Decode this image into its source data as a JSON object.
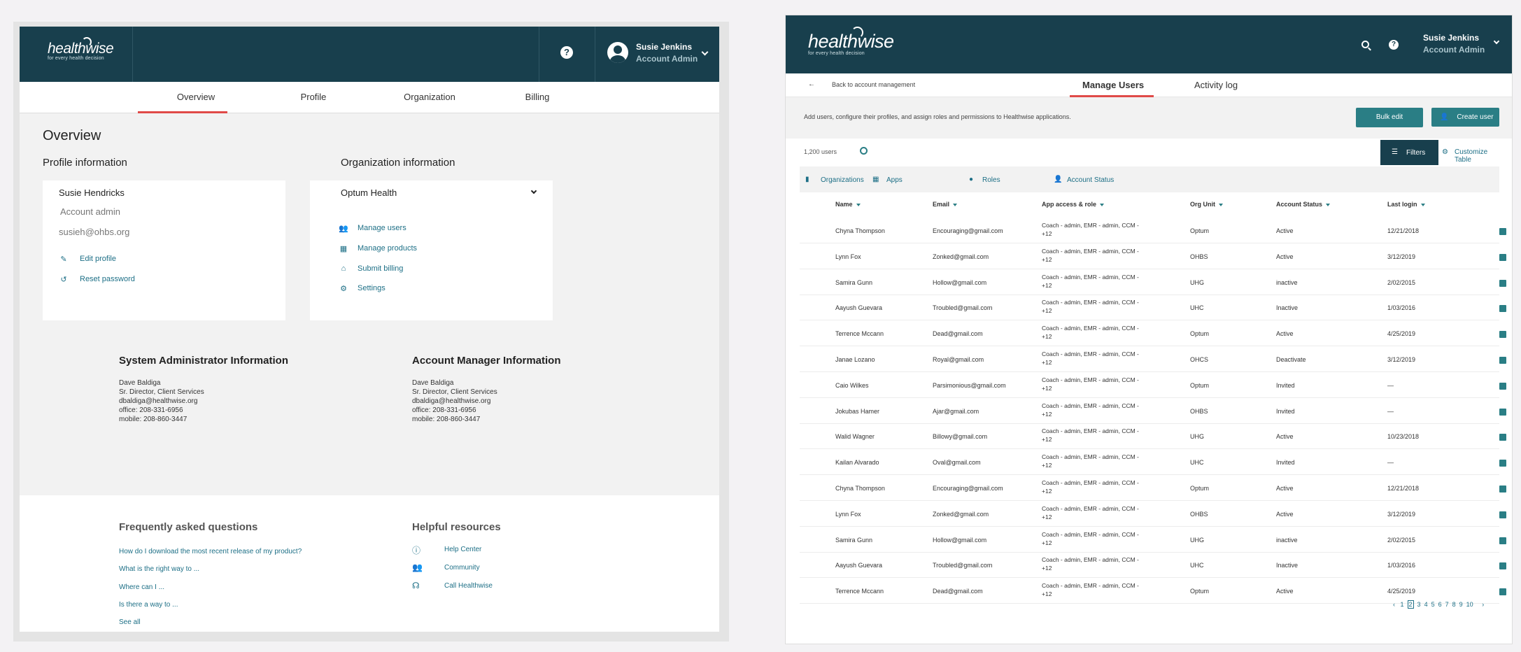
{
  "left": {
    "user": {
      "name": "Susie Jenkins",
      "role": "Account Admin"
    },
    "logo": {
      "word": "healthwise",
      "tagline": "for every health decision"
    },
    "tabs": [
      "Overview",
      "Profile",
      "Organization",
      "Billing"
    ],
    "page_title": "Overview",
    "profile": {
      "heading": "Profile information",
      "name": "Susie Hendricks",
      "role": "Account admin",
      "email": "susieh@ohbs.org",
      "edit_label": "Edit profile",
      "reset_label": "Reset password"
    },
    "org": {
      "heading": "Organization information",
      "selected": "Optum Health",
      "links": [
        "Manage users",
        "Manage products",
        "Submit billing",
        "Settings"
      ]
    },
    "sysadmin": {
      "title": "System Administrator Information",
      "lines": [
        "Dave Baldiga",
        "Sr. Director, Client Services",
        "dbaldiga@healthwise.org",
        "office: 208-331-6956",
        "mobile: 208-860-3447"
      ]
    },
    "acctmgr": {
      "title": "Account Manager Information",
      "lines": [
        "Dave Baldiga",
        "Sr. Director, Client Services",
        "dbaldiga@healthwise.org",
        "office: 208-331-6956",
        "mobile: 208-860-3447"
      ]
    },
    "faq": {
      "title": "Frequently asked questions",
      "links": [
        "How do I download the most recent release of my product?",
        "What is the right way to ...",
        "Where can I ...",
        "Is there a way to ...",
        "See all"
      ]
    },
    "resources": {
      "title": "Helpful resources",
      "links": [
        "Help Center",
        "Community",
        "Call Healthwise"
      ]
    }
  },
  "right": {
    "user": {
      "name": "Susie Jenkins",
      "role": "Account Admin"
    },
    "logo": {
      "word": "healthwise",
      "tagline": "for every health decision"
    },
    "back_label": "Back to account management",
    "tabs": [
      "Manage Users",
      "Activity log"
    ],
    "description": "Add users, configure their profiles, and assign roles and permissions to Healthwise applications.",
    "bulk_edit": "Bulk edit",
    "create_user": "Create user",
    "user_count": "1,200 users",
    "filters_label": "Filters",
    "customize_label": "Customize Table",
    "filter_tabs": [
      "Organizations",
      "Apps",
      "Roles",
      "Account Status"
    ],
    "columns": [
      "Name",
      "Email",
      "App access & role",
      "Org Unit",
      "Account Status",
      "Last login"
    ],
    "app_access": [
      "Coach - admin, EMR - admin, CCM -",
      "+12"
    ],
    "rows": [
      [
        "Chyna Thompson",
        "Encouraging@gmail.com",
        "Optum",
        "Active",
        "12/21/2018"
      ],
      [
        "Lynn Fox",
        "Zonked@gmail.com",
        "OHBS",
        "Active",
        "3/12/2019"
      ],
      [
        "Samira Gunn",
        "Hollow@gmail.com",
        "UHG",
        "inactive",
        "2/02/2015"
      ],
      [
        "Aayush Guevara",
        "Troubled@gmail.com",
        "UHC",
        "Inactive",
        "1/03/2016"
      ],
      [
        "Terrence Mccann",
        "Dead@gmail.com",
        "Optum",
        "Active",
        "4/25/2019"
      ],
      [
        "Janae Lozano",
        "Royal@gmail.com",
        "OHCS",
        "Deactivate",
        "3/12/2019"
      ],
      [
        "Caio Wilkes",
        "Parsimonious@gmail.com",
        "Optum",
        "Invited",
        "—"
      ],
      [
        "Jokubas Hamer",
        "Ajar@gmail.com",
        "OHBS",
        "Invited",
        "—"
      ],
      [
        "Walid Wagner",
        "Billowy@gmail.com",
        "UHG",
        "Active",
        "10/23/2018"
      ],
      [
        "Kailan Alvarado",
        "Oval@gmail.com",
        "UHC",
        "Invited",
        "—"
      ],
      [
        "Chyna Thompson",
        "Encouraging@gmail.com",
        "Optum",
        "Active",
        "12/21/2018"
      ],
      [
        "Lynn Fox",
        "Zonked@gmail.com",
        "OHBS",
        "Active",
        "3/12/2019"
      ],
      [
        "Samira Gunn",
        "Hollow@gmail.com",
        "UHG",
        "inactive",
        "2/02/2015"
      ],
      [
        "Aayush Guevara",
        "Troubled@gmail.com",
        "UHC",
        "Inactive",
        "1/03/2016"
      ],
      [
        "Terrence Mccann",
        "Dead@gmail.com",
        "Optum",
        "Active",
        "4/25/2019"
      ]
    ],
    "pages": [
      "1",
      "2",
      "3",
      "4",
      "5",
      "6",
      "7",
      "8",
      "9",
      "10"
    ],
    "current_page": "2",
    "colors": {
      "header": "#183f4d",
      "accent": "#e04a48",
      "teal": "#2a7e85",
      "link": "#1d6f86"
    }
  }
}
